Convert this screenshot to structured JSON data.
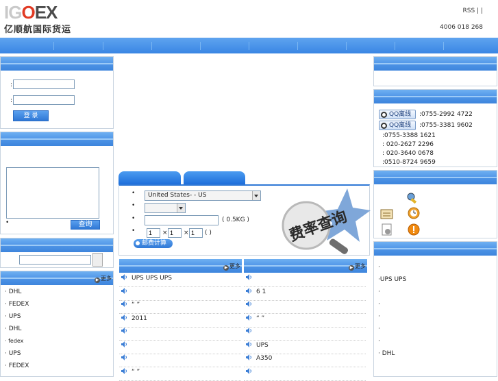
{
  "header": {
    "logo_en_a": "IG",
    "logo_en_b": "O",
    "logo_en_c": "EX",
    "logo_cn": "亿顺航国际货运",
    "rss": "RSS  |     |",
    "phone": "4006 018 268"
  },
  "login": {
    "colon1": ":",
    "colon2": ":",
    "login_label": "登  录"
  },
  "tracking": {
    "bullet": "•",
    "query_label": "查询"
  },
  "left_list": {
    "more": "更多",
    "items": [
      "· DHL",
      "· FEDEX",
      "· UPS",
      "· DHL",
      "· fedex",
      "· UPS",
      "· FEDEX"
    ]
  },
  "calculator": {
    "country_value": "United States-   - US",
    "weight_unit": "( 0.5KG     )",
    "dim1": "1",
    "dim2": "1",
    "dim3": "1",
    "times1": "×",
    "times2": "×",
    "dim_unit": "( )",
    "calc_button": "邮费计算",
    "bullets": [
      "•",
      "•",
      "•",
      "•"
    ],
    "promo_text": "费率查询"
  },
  "news_left": {
    "more": "更多",
    "rows": [
      "UPS    UPS    UPS",
      "",
      "“  ”",
      "2011",
      "",
      "",
      "",
      "“ ”"
    ]
  },
  "news_right": {
    "more": "更多",
    "rows": [
      "",
      "6 1",
      "",
      "“   ”",
      "",
      "UPS",
      "A350",
      ""
    ]
  },
  "contact": {
    "qq_label": "QQ离线",
    "qq1_phone": ":0755-2992 4722",
    "qq2_phone": ":0755-3381 9602",
    "phones": [
      ":0755-3388 1621",
      ": 020-2627 2296",
      ": 020-3640 0678",
      ":0510-8724 9659"
    ]
  },
  "right_list": {
    "items": [
      "·",
      "·UPS     UPS",
      "·",
      "·",
      "·",
      "·",
      "·",
      "·  DHL"
    ]
  }
}
